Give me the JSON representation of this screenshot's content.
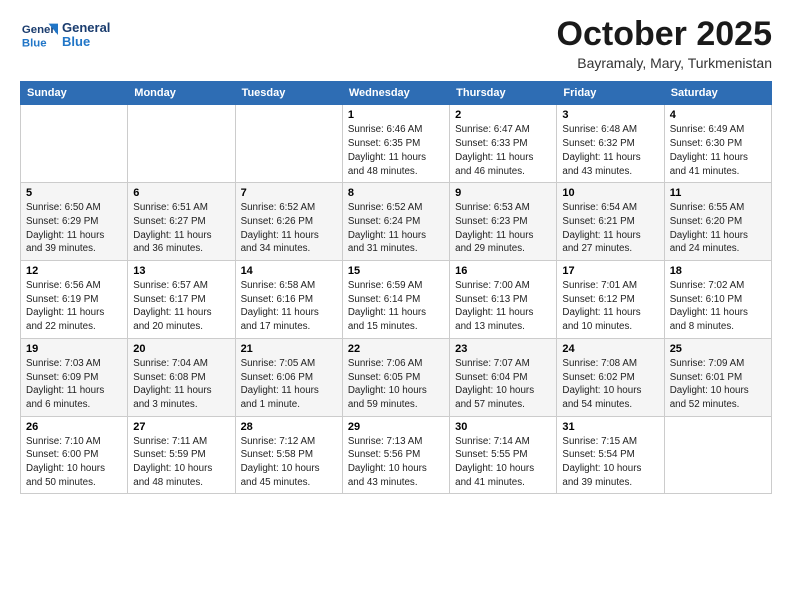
{
  "header": {
    "logo_general": "General",
    "logo_blue": "Blue",
    "month_title": "October 2025",
    "location": "Bayramaly, Mary, Turkmenistan"
  },
  "days_of_week": [
    "Sunday",
    "Monday",
    "Tuesday",
    "Wednesday",
    "Thursday",
    "Friday",
    "Saturday"
  ],
  "weeks": [
    [
      {
        "day": "",
        "info": ""
      },
      {
        "day": "",
        "info": ""
      },
      {
        "day": "",
        "info": ""
      },
      {
        "day": "1",
        "info": "Sunrise: 6:46 AM\nSunset: 6:35 PM\nDaylight: 11 hours\nand 48 minutes."
      },
      {
        "day": "2",
        "info": "Sunrise: 6:47 AM\nSunset: 6:33 PM\nDaylight: 11 hours\nand 46 minutes."
      },
      {
        "day": "3",
        "info": "Sunrise: 6:48 AM\nSunset: 6:32 PM\nDaylight: 11 hours\nand 43 minutes."
      },
      {
        "day": "4",
        "info": "Sunrise: 6:49 AM\nSunset: 6:30 PM\nDaylight: 11 hours\nand 41 minutes."
      }
    ],
    [
      {
        "day": "5",
        "info": "Sunrise: 6:50 AM\nSunset: 6:29 PM\nDaylight: 11 hours\nand 39 minutes."
      },
      {
        "day": "6",
        "info": "Sunrise: 6:51 AM\nSunset: 6:27 PM\nDaylight: 11 hours\nand 36 minutes."
      },
      {
        "day": "7",
        "info": "Sunrise: 6:52 AM\nSunset: 6:26 PM\nDaylight: 11 hours\nand 34 minutes."
      },
      {
        "day": "8",
        "info": "Sunrise: 6:52 AM\nSunset: 6:24 PM\nDaylight: 11 hours\nand 31 minutes."
      },
      {
        "day": "9",
        "info": "Sunrise: 6:53 AM\nSunset: 6:23 PM\nDaylight: 11 hours\nand 29 minutes."
      },
      {
        "day": "10",
        "info": "Sunrise: 6:54 AM\nSunset: 6:21 PM\nDaylight: 11 hours\nand 27 minutes."
      },
      {
        "day": "11",
        "info": "Sunrise: 6:55 AM\nSunset: 6:20 PM\nDaylight: 11 hours\nand 24 minutes."
      }
    ],
    [
      {
        "day": "12",
        "info": "Sunrise: 6:56 AM\nSunset: 6:19 PM\nDaylight: 11 hours\nand 22 minutes."
      },
      {
        "day": "13",
        "info": "Sunrise: 6:57 AM\nSunset: 6:17 PM\nDaylight: 11 hours\nand 20 minutes."
      },
      {
        "day": "14",
        "info": "Sunrise: 6:58 AM\nSunset: 6:16 PM\nDaylight: 11 hours\nand 17 minutes."
      },
      {
        "day": "15",
        "info": "Sunrise: 6:59 AM\nSunset: 6:14 PM\nDaylight: 11 hours\nand 15 minutes."
      },
      {
        "day": "16",
        "info": "Sunrise: 7:00 AM\nSunset: 6:13 PM\nDaylight: 11 hours\nand 13 minutes."
      },
      {
        "day": "17",
        "info": "Sunrise: 7:01 AM\nSunset: 6:12 PM\nDaylight: 11 hours\nand 10 minutes."
      },
      {
        "day": "18",
        "info": "Sunrise: 7:02 AM\nSunset: 6:10 PM\nDaylight: 11 hours\nand 8 minutes."
      }
    ],
    [
      {
        "day": "19",
        "info": "Sunrise: 7:03 AM\nSunset: 6:09 PM\nDaylight: 11 hours\nand 6 minutes."
      },
      {
        "day": "20",
        "info": "Sunrise: 7:04 AM\nSunset: 6:08 PM\nDaylight: 11 hours\nand 3 minutes."
      },
      {
        "day": "21",
        "info": "Sunrise: 7:05 AM\nSunset: 6:06 PM\nDaylight: 11 hours\nand 1 minute."
      },
      {
        "day": "22",
        "info": "Sunrise: 7:06 AM\nSunset: 6:05 PM\nDaylight: 10 hours\nand 59 minutes."
      },
      {
        "day": "23",
        "info": "Sunrise: 7:07 AM\nSunset: 6:04 PM\nDaylight: 10 hours\nand 57 minutes."
      },
      {
        "day": "24",
        "info": "Sunrise: 7:08 AM\nSunset: 6:02 PM\nDaylight: 10 hours\nand 54 minutes."
      },
      {
        "day": "25",
        "info": "Sunrise: 7:09 AM\nSunset: 6:01 PM\nDaylight: 10 hours\nand 52 minutes."
      }
    ],
    [
      {
        "day": "26",
        "info": "Sunrise: 7:10 AM\nSunset: 6:00 PM\nDaylight: 10 hours\nand 50 minutes."
      },
      {
        "day": "27",
        "info": "Sunrise: 7:11 AM\nSunset: 5:59 PM\nDaylight: 10 hours\nand 48 minutes."
      },
      {
        "day": "28",
        "info": "Sunrise: 7:12 AM\nSunset: 5:58 PM\nDaylight: 10 hours\nand 45 minutes."
      },
      {
        "day": "29",
        "info": "Sunrise: 7:13 AM\nSunset: 5:56 PM\nDaylight: 10 hours\nand 43 minutes."
      },
      {
        "day": "30",
        "info": "Sunrise: 7:14 AM\nSunset: 5:55 PM\nDaylight: 10 hours\nand 41 minutes."
      },
      {
        "day": "31",
        "info": "Sunrise: 7:15 AM\nSunset: 5:54 PM\nDaylight: 10 hours\nand 39 minutes."
      },
      {
        "day": "",
        "info": ""
      }
    ]
  ]
}
